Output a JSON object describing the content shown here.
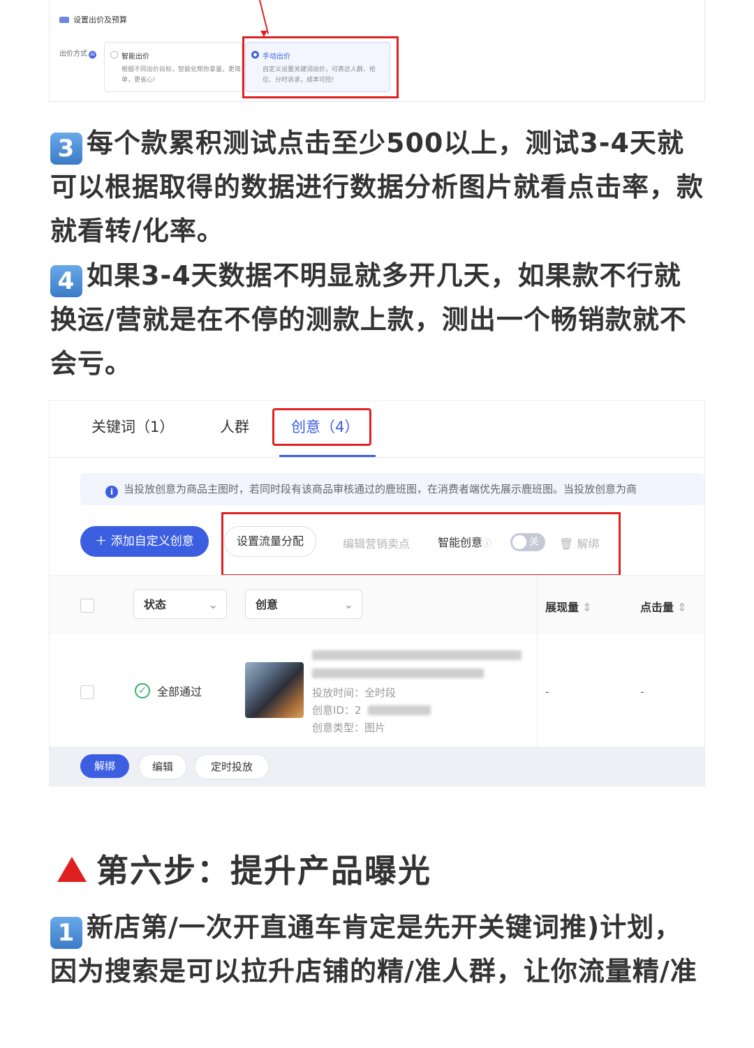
{
  "bid_panel": {
    "title": "设置出价及预算",
    "method_label": "出价方式",
    "ai_badge": "AI",
    "option_smart_title": "智能出价",
    "option_smart_desc": "根据不同出价目标，智能化帮你拿量，更简单，更省心!",
    "option_manual_title": "手动出价",
    "option_manual_desc": "自定义设置关键词出价，可表达人群、抢位、分时诉求，成本可控!"
  },
  "paragraphs": {
    "p3_num": "3",
    "p3_text": "每个款累积测试点击至少500以上，测试3-4天就可以根据取得的数据进行数据分析图片就看点击率，款就看转/化率。",
    "p4_num": "4",
    "p4_text": "如果3-4天数据不明显就多开几天，如果款不行就换运/营就是在不停的测款上款，测出一个畅销款就不会亏。"
  },
  "creative_panel": {
    "tabs": [
      "关键词（1）",
      "人群",
      "创意（4）"
    ],
    "active_tab_index": 2,
    "notice": "当投放创意为商品主图时，若同时段有该商品审核通过的鹿班图，在消费者端优先展示鹿班图。当投放创意为商",
    "add_button": "添加自定义创意",
    "traffic_button": "设置流量分配",
    "edit_selling_point": "编辑营销卖点",
    "smart_creative_label": "智能创意",
    "toggle_label": "关",
    "unbind_label": "解绑",
    "filter_status": "状态",
    "filter_creative": "创意",
    "col_impressions": "展现量",
    "col_clicks": "点击量",
    "row": {
      "status": "全部通过",
      "schedule": "投放时间：全时段",
      "creative_id": "创意ID：2",
      "creative_type": "创意类型：图片",
      "impressions": "-",
      "clicks": "-"
    },
    "footer_buttons": [
      "解绑",
      "编辑",
      "定时投放"
    ]
  },
  "step_heading": "第六步：提升产品曝光",
  "step1": {
    "num": "1",
    "text": "新店第/一次开直通车肯定是先开关键词推)计划，因为搜索是可以拉升店铺的精/准人群，让你流量精/准"
  }
}
